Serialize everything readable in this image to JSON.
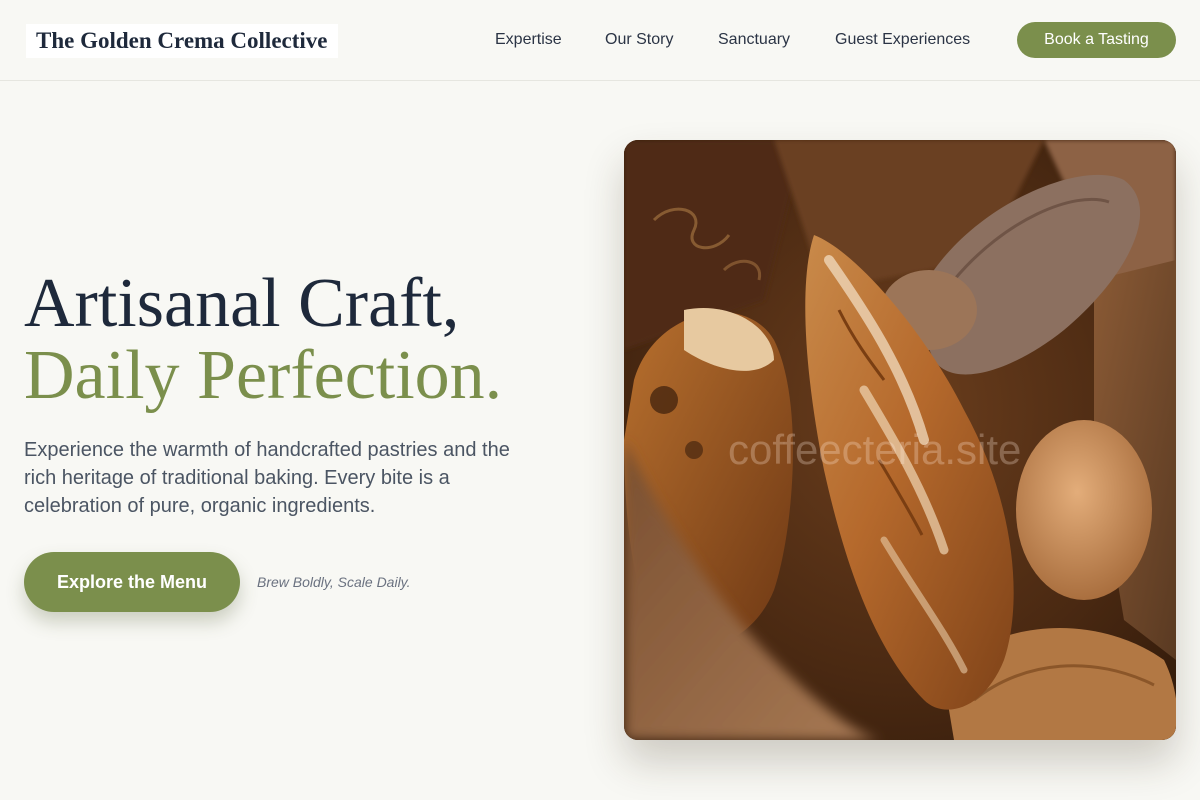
{
  "header": {
    "logo": "The Golden Crema Collective",
    "nav": {
      "expertise": "Expertise",
      "story": "Our Story",
      "sanctuary": "Sanctuary",
      "guest": "Guest Experiences"
    },
    "cta": "Book a Tasting"
  },
  "hero": {
    "title_line1": "Artisanal Craft,",
    "title_line2": "Daily Perfection.",
    "description": "Experience the warmth of handcrafted pastries and the rich heritage of traditional baking. Every bite is a celebration of pure, organic ingredients.",
    "button": "Explore the Menu",
    "tagline": "Brew Boldly, Scale Daily.",
    "image_watermark": "coffeecteria.site"
  },
  "colors": {
    "accent": "#7b8f4c",
    "heading": "#1e293b",
    "background": "#f8f8f4"
  }
}
